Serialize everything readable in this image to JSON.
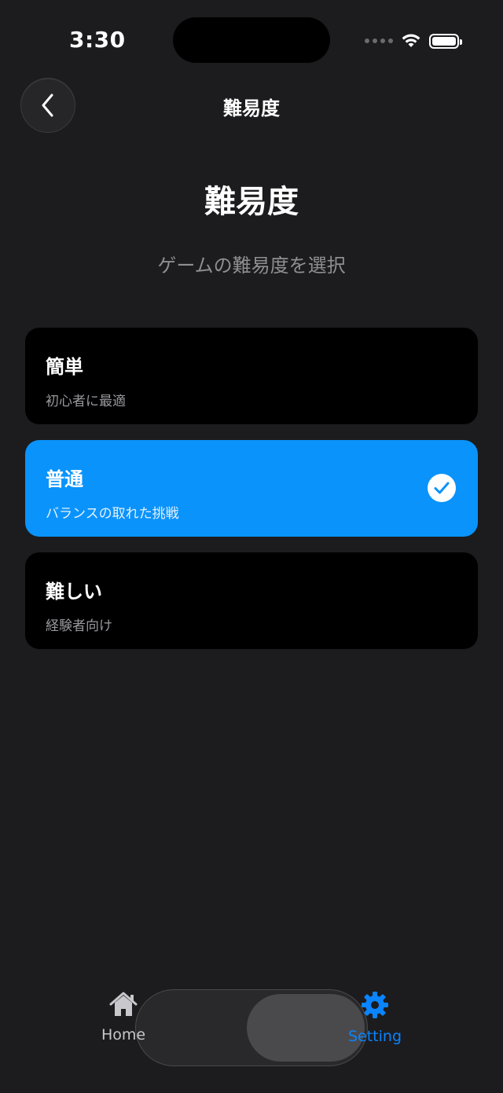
{
  "status_bar": {
    "time": "3:30",
    "icons": [
      "signal-icon",
      "wifi-icon",
      "battery-icon"
    ]
  },
  "nav": {
    "back_icon": "chevron-left-icon",
    "title": "難易度"
  },
  "header": {
    "title": "難易度",
    "subtitle": "ゲームの難易度を選択"
  },
  "options": [
    {
      "title": "簡単",
      "description": "初心者に最適",
      "selected": false
    },
    {
      "title": "普通",
      "description": "バランスの取れた挑戦",
      "selected": true
    },
    {
      "title": "難しい",
      "description": "経験者向け",
      "selected": false
    }
  ],
  "tab_bar": {
    "items": [
      {
        "label": "Home",
        "icon": "house-icon",
        "active": false
      },
      {
        "label": "Setting",
        "icon": "gear-icon",
        "active": true
      }
    ]
  },
  "colors": {
    "background": "#1c1c1e",
    "card": "#000000",
    "accent": "#0a93fb",
    "secondary_text": "#8e8e93",
    "tab_active": "#0a84ff",
    "tab_inactive": "#c7c7cc"
  }
}
